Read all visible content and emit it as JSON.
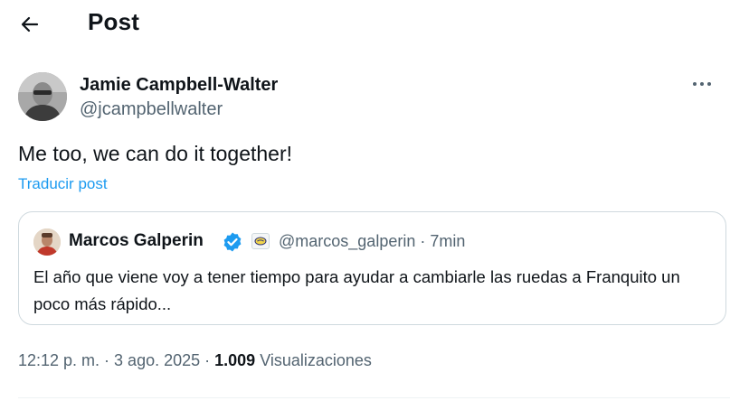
{
  "header": {
    "title": "Post",
    "back_icon": "arrow-left-icon"
  },
  "author": {
    "name": "Jamie Campbell-Walter",
    "handle": "@jcampbellwalter",
    "more_icon": "more-horizontal-icon"
  },
  "post": {
    "text": "Me too, we can do it together!",
    "translate_label": "Traducir post"
  },
  "quote": {
    "name": "Marcos Galperin",
    "handle_time": "@marcos_galperin · 7min",
    "verified_icon": "verified-badge-icon",
    "affiliate_icon": "affiliate-badge-icon",
    "text": "El año que viene voy a tener tiempo para ayudar a cambiarle las ruedas a Franquito un poco más rápido..."
  },
  "meta": {
    "time_date": "12:12 p. m. · 3 ago. 2025 · ",
    "views_count": "1.009",
    "views_label": " Visualizaciones"
  },
  "colors": {
    "accent": "#1d9bf0",
    "text_primary": "#0f1419",
    "text_secondary": "#536471",
    "border": "#cfd9de"
  }
}
